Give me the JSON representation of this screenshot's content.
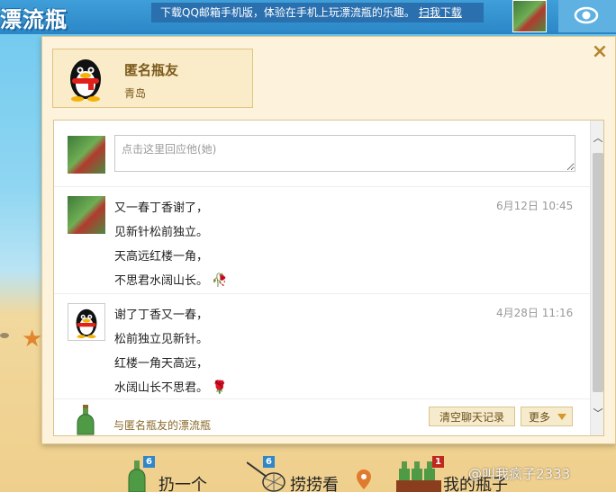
{
  "app": {
    "logo_text": "漂流瓶"
  },
  "promo": {
    "text": "下载QQ邮箱手机版，体验在手机上玩漂流瓶的乐趣。",
    "link_label": "扫我下载"
  },
  "colors": {
    "dialog_bg": "#fdf3dc",
    "accent_gold": "#b58630",
    "sky": "#6ec8ee",
    "sand": "#efcf8c"
  },
  "profile": {
    "name": "匿名瓶友",
    "city": "青岛"
  },
  "reply": {
    "placeholder": "点击这里回应他(她)"
  },
  "messages": [
    {
      "avatar": "photo",
      "time": "6月12日 10:45",
      "lines": [
        "又一春丁香谢了，",
        "见新针松前独立。",
        "天高远红楼一角，",
        "不思君水阔山长。"
      ],
      "emoji": "wilted-rose-icon"
    },
    {
      "avatar": "penguin",
      "time": "4月28日 11:16",
      "lines": [
        "谢了丁香又一春，",
        "松前独立见新针。",
        "红楼一角天高远，",
        "水阔山长不思君。"
      ],
      "emoji": "rose-icon"
    }
  ],
  "footer": {
    "label": "与匿名瓶友的漂流瓶",
    "clear_label": "清空聊天记录",
    "more_label": "更多"
  },
  "bottom_nav": {
    "throw": {
      "label": "扔一个",
      "badge": "6"
    },
    "fish": {
      "label": "捞捞看",
      "badge": "6"
    },
    "mine": {
      "label": "我的瓶子",
      "badge": "1"
    }
  },
  "watermark": "@叫我疯子2333"
}
